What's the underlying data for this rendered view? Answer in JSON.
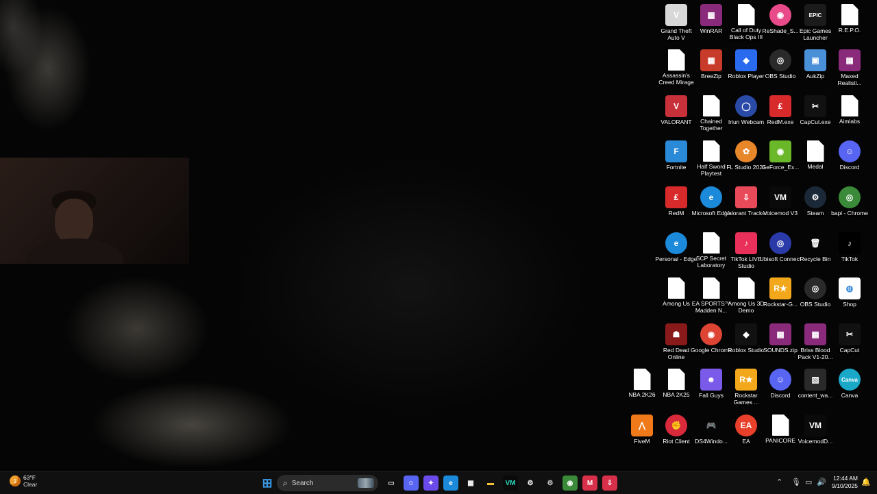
{
  "desktop": {
    "icons": [
      {
        "label": "Grand Theft Auto V",
        "icon": "gta5-icon",
        "style": "rgba(0,0,0,0)",
        "color": "#d8d8d8",
        "glyph": "V"
      },
      {
        "label": "WinRAR",
        "icon": "winrar-icon",
        "style": "",
        "color": "#8a2a7a",
        "glyph": "▦"
      },
      {
        "label": "Call of Duty Black Ops III",
        "icon": "file-icon",
        "style": "doc",
        "color": "#ffffff",
        "glyph": ""
      },
      {
        "label": "ReShade_S...",
        "icon": "reshade-icon",
        "style": "circle",
        "color": "#e84a8a",
        "glyph": "◉"
      },
      {
        "label": "Epic Games Launcher",
        "icon": "epic-games-icon",
        "style": "",
        "color": "#1b1b1b",
        "glyph": "EPIC"
      },
      {
        "label": "R.E.P.O.",
        "icon": "file-icon",
        "style": "doc",
        "color": "#ffffff",
        "glyph": ""
      },
      {
        "label": "Assassin's Creed Mirage",
        "icon": "file-icon",
        "style": "doc",
        "color": "#ffffff",
        "glyph": ""
      },
      {
        "label": "BreeZip",
        "icon": "breezip-icon",
        "style": "",
        "color": "#c83a2a",
        "glyph": "▦"
      },
      {
        "label": "Roblox Player",
        "icon": "roblox-icon",
        "style": "",
        "color": "#2a6aee",
        "glyph": "◆"
      },
      {
        "label": "OBS Studio",
        "icon": "obs-icon",
        "style": "circle",
        "color": "#2a2a2a",
        "glyph": "◎"
      },
      {
        "label": "AukZip",
        "icon": "aukzip-icon",
        "style": "",
        "color": "#4a90d8",
        "glyph": "▣"
      },
      {
        "label": "Maxed Realisti...",
        "icon": "archive-icon",
        "style": "",
        "color": "#8a2a7a",
        "glyph": "▦"
      },
      {
        "label": "VALORANT",
        "icon": "valorant-icon",
        "style": "",
        "color": "#c8303a",
        "glyph": "V"
      },
      {
        "label": "Chained Together",
        "icon": "file-icon",
        "style": "doc",
        "color": "#ffffff",
        "glyph": ""
      },
      {
        "label": "Iriun Webcam",
        "icon": "iriun-icon",
        "style": "circle",
        "color": "#2a4aa8",
        "glyph": "◯"
      },
      {
        "label": "RedM.exe",
        "icon": "redm-icon",
        "style": "",
        "color": "#d82a2a",
        "glyph": "₤"
      },
      {
        "label": "CapCut.exe",
        "icon": "capcut-icon",
        "style": "",
        "color": "#111111",
        "glyph": "✂"
      },
      {
        "label": "Aimlabs",
        "icon": "file-icon",
        "style": "doc",
        "color": "#ffffff",
        "glyph": ""
      },
      {
        "label": "Fortnite",
        "icon": "fortnite-icon",
        "style": "",
        "color": "#2a8ad8",
        "glyph": "F"
      },
      {
        "label": "Half Sword Playtest",
        "icon": "file-icon",
        "style": "doc",
        "color": "#ffffff",
        "glyph": ""
      },
      {
        "label": "FL Studio 2024",
        "icon": "fl-studio-icon",
        "style": "circle",
        "color": "#e8862a",
        "glyph": "✿"
      },
      {
        "label": "GeForce_Ex...",
        "icon": "geforce-icon",
        "style": "",
        "color": "#6ab82a",
        "glyph": "◉"
      },
      {
        "label": "Medal",
        "icon": "file-icon",
        "style": "doc",
        "color": "#ffffff",
        "glyph": ""
      },
      {
        "label": "Discord",
        "icon": "discord-icon",
        "style": "circle",
        "color": "#5865f2",
        "glyph": "☺"
      },
      {
        "label": "RedM",
        "icon": "redm-icon",
        "style": "",
        "color": "#d82a2a",
        "glyph": "₤"
      },
      {
        "label": "Microsoft Edge",
        "icon": "edge-icon",
        "style": "circle",
        "color": "#1c8adb",
        "glyph": "e"
      },
      {
        "label": "Valorant Tracker",
        "icon": "valorant-tracker-icon",
        "style": "",
        "color": "#e84a5a",
        "glyph": "⇩"
      },
      {
        "label": "Voicemod V3",
        "icon": "voicemod-icon",
        "style": "",
        "color": "#0a0a0a",
        "glyph": "VM"
      },
      {
        "label": "Steam",
        "icon": "steam-icon",
        "style": "circle",
        "color": "#1b2838",
        "glyph": "⚙"
      },
      {
        "label": "bapi - Chrome",
        "icon": "chrome-profile-icon",
        "style": "circle",
        "color": "#3a8a3a",
        "glyph": "◎"
      },
      {
        "label": "Personal - Edge",
        "icon": "edge-icon",
        "style": "circle",
        "color": "#1c8adb",
        "glyph": "e"
      },
      {
        "label": "SCP Secret Laboratory",
        "icon": "file-icon",
        "style": "doc",
        "color": "#ffffff",
        "glyph": ""
      },
      {
        "label": "TikTok LIVE Studio",
        "icon": "tiktok-live-icon",
        "style": "",
        "color": "#e8305a",
        "glyph": "♪"
      },
      {
        "label": "Ubisoft Connect",
        "icon": "ubisoft-icon",
        "style": "circle",
        "color": "#2a3aa8",
        "glyph": "◎"
      },
      {
        "label": "Recycle Bin",
        "icon": "recycle-bin-icon",
        "style": "",
        "color": "rgba(0,0,0,0)",
        "glyph": "🗑"
      },
      {
        "label": "TikTok",
        "icon": "tiktok-icon",
        "style": "",
        "color": "#000000",
        "glyph": "♪"
      },
      {
        "label": "Among Us",
        "icon": "file-icon",
        "style": "doc",
        "color": "#ffffff",
        "glyph": ""
      },
      {
        "label": "EA SPORTS™ Madden N...",
        "icon": "file-icon",
        "style": "doc",
        "color": "#ffffff",
        "glyph": ""
      },
      {
        "label": "Among Us 3D Demo",
        "icon": "file-icon",
        "style": "doc",
        "color": "#ffffff",
        "glyph": ""
      },
      {
        "label": "Rockstar-G...",
        "icon": "rockstar-icon",
        "style": "",
        "color": "#f2a81a",
        "glyph": "R★"
      },
      {
        "label": "OBS Studio",
        "icon": "obs-icon",
        "style": "circle",
        "color": "#2a2a2a",
        "glyph": "◎"
      },
      {
        "label": "Shop",
        "icon": "shop-icon",
        "style": "",
        "color": "#ffffff",
        "glyph": "◍"
      },
      {
        "label": "Red Dead Online",
        "icon": "red-dead-online-icon",
        "style": "",
        "color": "#8a1a1a",
        "glyph": "☗"
      },
      {
        "label": "Google Chrome",
        "icon": "chrome-icon",
        "style": "circle",
        "color": "#dd4433",
        "glyph": "◉"
      },
      {
        "label": "Roblox Studio",
        "icon": "roblox-studio-icon",
        "style": "",
        "color": "#111111",
        "glyph": "◆"
      },
      {
        "label": "SOUNDS.zip",
        "icon": "archive-icon",
        "style": "",
        "color": "#8a2a7a",
        "glyph": "▦"
      },
      {
        "label": "Briss Blood Pack V1-20...",
        "icon": "archive-icon",
        "style": "",
        "color": "#8a2a7a",
        "glyph": "▦"
      },
      {
        "label": "CapCut",
        "icon": "capcut-icon",
        "style": "",
        "color": "#111111",
        "glyph": "✂"
      },
      {
        "label": "NBA 2K26",
        "icon": "file-icon",
        "style": "doc",
        "color": "#ffffff",
        "glyph": ""
      },
      {
        "label": "NBA 2K25",
        "icon": "file-icon",
        "style": "doc",
        "color": "#ffffff",
        "glyph": ""
      },
      {
        "label": "Fall Guys",
        "icon": "fall-guys-icon",
        "style": "",
        "color": "#7a5ae8",
        "glyph": "☻"
      },
      {
        "label": "Rockstar Games ...",
        "icon": "rockstar-icon",
        "style": "",
        "color": "#f2a81a",
        "glyph": "R★"
      },
      {
        "label": "Discord",
        "icon": "discord-icon",
        "style": "circle",
        "color": "#5865f2",
        "glyph": "☺"
      },
      {
        "label": "content_wa...",
        "icon": "image-file-icon",
        "style": "",
        "color": "#2a2a2a",
        "glyph": "▧"
      },
      {
        "label": "Canva",
        "icon": "canva-icon",
        "style": "circle",
        "color": "#1aa8c8",
        "glyph": "Canva"
      },
      {
        "label": "FiveM",
        "icon": "fivem-icon",
        "style": "",
        "color": "#f07a1a",
        "glyph": "⋀"
      },
      {
        "label": "Riot Client",
        "icon": "riot-client-icon",
        "style": "circle",
        "color": "#d82a3a",
        "glyph": "✊"
      },
      {
        "label": "DS4Windo...",
        "icon": "ds4windows-icon",
        "style": "",
        "color": "rgba(0,0,0,0)",
        "glyph": "🎮"
      },
      {
        "label": "EA",
        "icon": "ea-icon",
        "style": "circle",
        "color": "#e8402a",
        "glyph": "EA"
      },
      {
        "label": "PANICORE",
        "icon": "file-icon",
        "style": "doc",
        "color": "#ffffff",
        "glyph": ""
      },
      {
        "label": "VoicemodD...",
        "icon": "voicemod-icon",
        "style": "",
        "color": "#0a0a0a",
        "glyph": "VM"
      }
    ]
  },
  "taskbar": {
    "weather": {
      "temp": "63°F",
      "condition": "Clear",
      "badge": "1",
      "icon": "weather-icon"
    },
    "search_label": "Search",
    "apps": [
      {
        "name": "start-button",
        "glyph": "⊞",
        "color": "#3a9ae8",
        "bg": "rgba(0,0,0,0)"
      },
      {
        "name": "task-view-icon",
        "glyph": "▭",
        "color": "#dddddd",
        "bg": "rgba(0,0,0,0)"
      },
      {
        "name": "discord-taskbar-icon",
        "glyph": "☺",
        "color": "#ffffff",
        "bg": "#5865f2"
      },
      {
        "name": "copilot-icon",
        "glyph": "✦",
        "color": "#ffffff",
        "bg": "#6a4ae8"
      },
      {
        "name": "edge-taskbar-icon",
        "glyph": "e",
        "color": "#ffffff",
        "bg": "#1c8adb"
      },
      {
        "name": "microsoft-store-icon",
        "glyph": "▦",
        "color": "#ffffff",
        "bg": "rgba(0,0,0,0)"
      },
      {
        "name": "file-explorer-icon",
        "glyph": "▬",
        "color": "#f2c230",
        "bg": "rgba(0,0,0,0)"
      },
      {
        "name": "voicemod-taskbar-icon",
        "glyph": "VM",
        "color": "#2ad8c0",
        "bg": "#0a0a0a"
      },
      {
        "name": "steam-taskbar-icon",
        "glyph": "⚙",
        "color": "#ffffff",
        "bg": "rgba(0,0,0,0)"
      },
      {
        "name": "settings-icon",
        "glyph": "⚙",
        "color": "#cccccc",
        "bg": "rgba(0,0,0,0)"
      },
      {
        "name": "chrome-taskbar-icon",
        "glyph": "◉",
        "color": "#ffffff",
        "bg": "#3a8a3a"
      },
      {
        "name": "app-red-icon",
        "glyph": "M",
        "color": "#ffffff",
        "bg": "#d8304a"
      },
      {
        "name": "valorant-tracker-taskbar-icon",
        "glyph": "⇩",
        "color": "#ffffff",
        "bg": "#d8304a"
      }
    ],
    "clock": {
      "time": "12:44 AM",
      "date": "9/10/2025"
    }
  }
}
